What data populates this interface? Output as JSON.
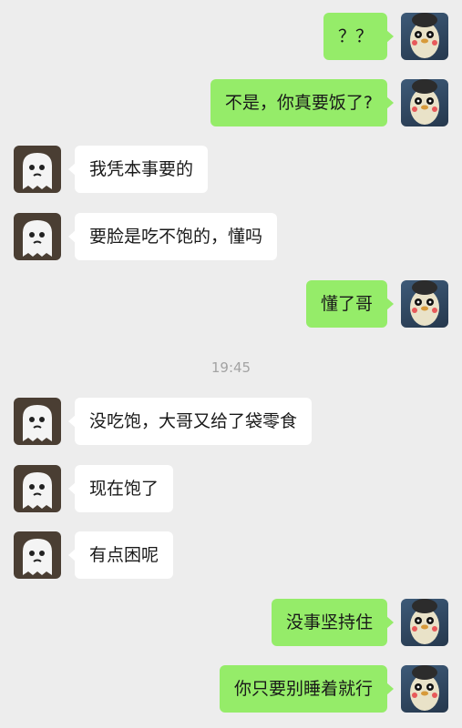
{
  "messages": [
    {
      "side": "right",
      "text": "？？"
    },
    {
      "side": "right",
      "text": "不是，你真要饭了?"
    },
    {
      "side": "left",
      "text": "我凭本事要的"
    },
    {
      "side": "left",
      "text": "要脸是吃不饱的，懂吗"
    },
    {
      "side": "right",
      "text": "懂了哥"
    },
    {
      "side": "left",
      "text": "没吃饱，大哥又给了袋零食"
    },
    {
      "side": "left",
      "text": "现在饱了"
    },
    {
      "side": "left",
      "text": "有点困呢"
    },
    {
      "side": "right",
      "text": "没事坚持住"
    },
    {
      "side": "right",
      "text": "你只要别睡着就行"
    }
  ],
  "timestamp": "19:45",
  "colors": {
    "background": "#ededed",
    "sent_bubble": "#95ec69",
    "received_bubble": "#ffffff",
    "timestamp_text": "#a3a3a3"
  },
  "avatars": {
    "left": "ghost-avatar",
    "right": "penguin-avatar"
  }
}
